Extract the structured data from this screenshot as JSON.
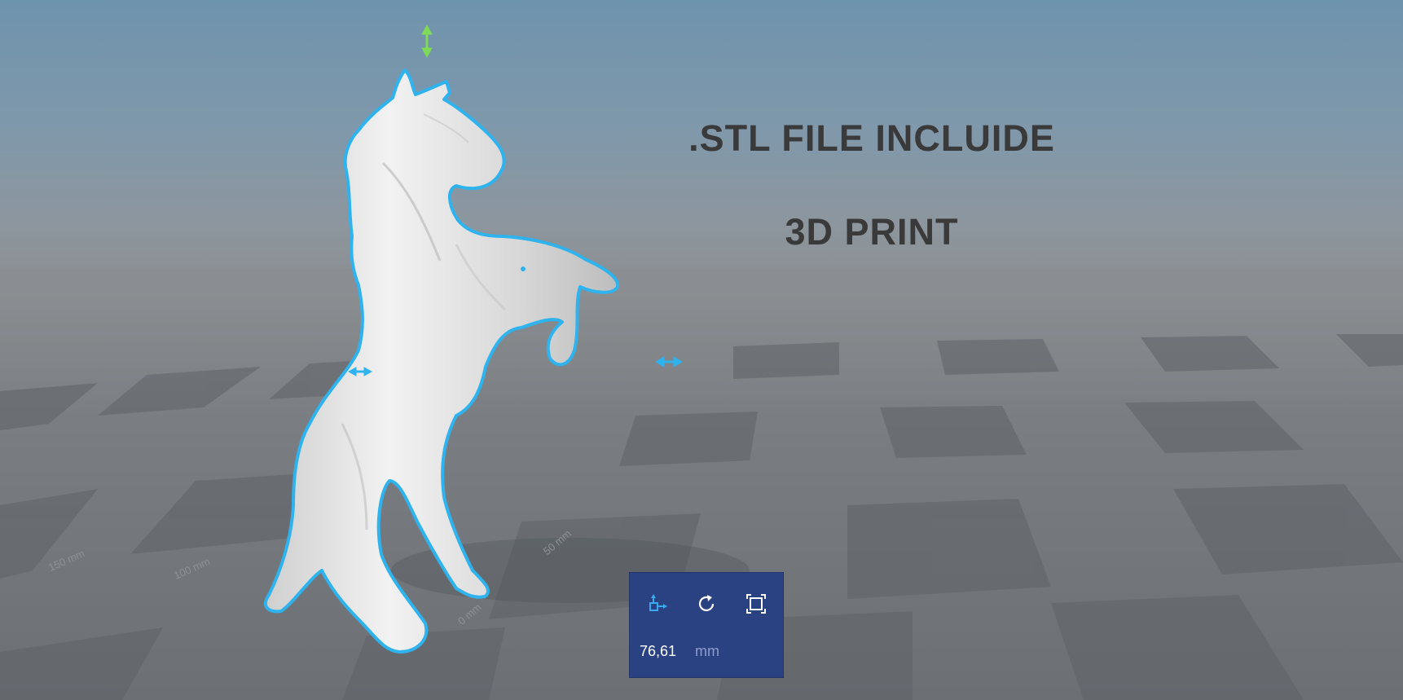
{
  "headline": {
    "line1": ".STL FILE INCLUIDE",
    "line2": "3D PRINT"
  },
  "toolbar": {
    "move_tool": "move-icon",
    "rotate_tool": "rotate-icon",
    "scale_tool": "scale-icon",
    "size_value": "76,61",
    "size_unit": "mm"
  },
  "ruler": {
    "labels": [
      "150 mm",
      "100 mm",
      "50 mm",
      "0 mm"
    ]
  },
  "colors": {
    "selection_outline": "#2fb3ee",
    "vertical_handle": "#7ed957",
    "toolbar_bg": "#2b4282",
    "active_tool": "#39a8ee"
  }
}
